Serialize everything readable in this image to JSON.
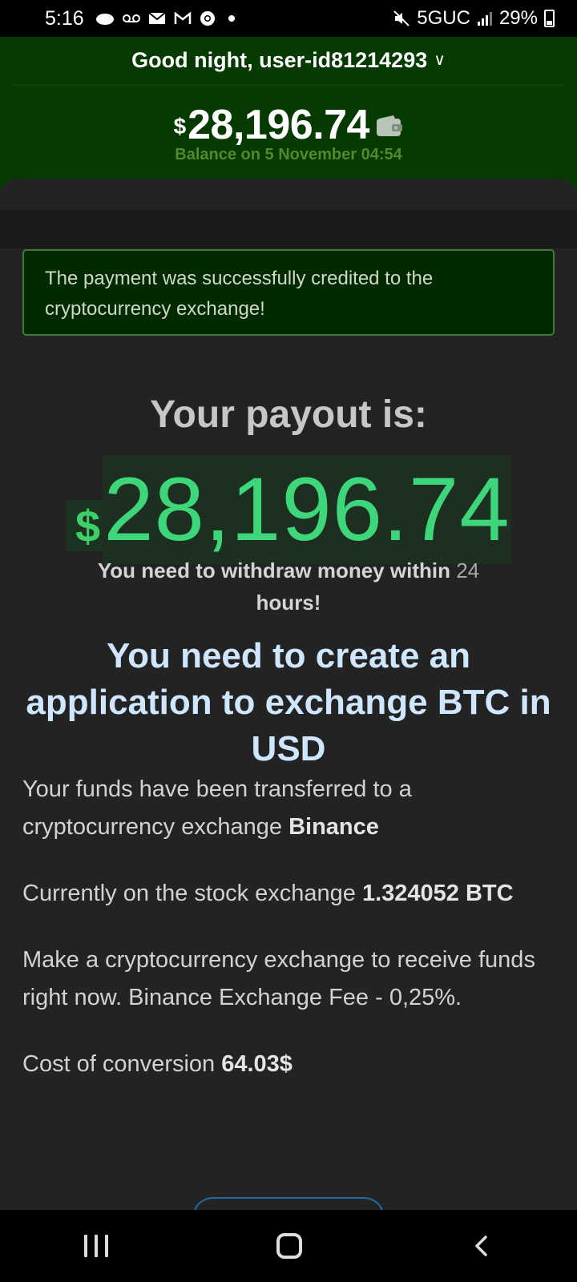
{
  "status_bar": {
    "time": "5:16",
    "network": "5GUC",
    "battery": "29%"
  },
  "header": {
    "greeting": "Good night, user-id81214293",
    "balance_currency": "$",
    "balance_amount": "28,196.74",
    "balance_date": "Balance on 5 November 04:54"
  },
  "notice": {
    "text": "The payment was successfully credited to the cryptocurrency exchange!"
  },
  "payout": {
    "title": "Your payout is:",
    "currency": "$",
    "amount": "28,196.74",
    "withdraw_prefix": "You need to withdraw money within",
    "withdraw_hours": "24",
    "withdraw_suffix": "hours!"
  },
  "heading": "You need to create an application to exchange BTC in USD",
  "paragraphs": {
    "p1_text": "Your funds have been transferred to a cryptocurrency exchange",
    "p1_bold": "Binance",
    "p2_text": "Currently on the stock exchange",
    "p2_bold": "1.324052 BTC",
    "p3_text": "Make a cryptocurrency exchange to receive funds right now. Binance Exchange Fee - 0,25%.",
    "p4_text": "Cost of conversion",
    "p4_bold": "64.03$"
  },
  "colors": {
    "header_bg": "#053a00",
    "accent_green": "#3ed67a",
    "heading_blue": "#cfe6ff"
  },
  "icons": [
    "wallet-icon",
    "chevron-down-icon",
    "recent-apps-icon",
    "home-icon",
    "back-icon"
  ]
}
